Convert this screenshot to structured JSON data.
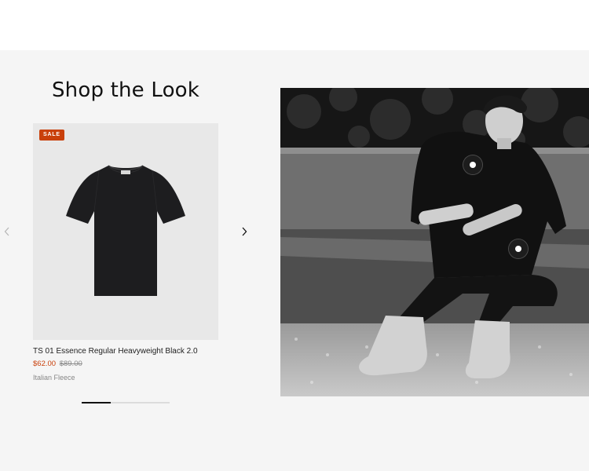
{
  "section": {
    "title": "Shop the Look",
    "background": "#f5f5f5"
  },
  "carousel": {
    "prev_icon": "chevron-left-icon",
    "next_icon": "chevron-right-icon",
    "progress_fraction": 0.33
  },
  "product": {
    "badge": "SALE",
    "badge_color": "#c9400b",
    "name": "TS 01 Essence Regular Heavyweight Black 2.0",
    "sale_price": "$62.00",
    "original_price": "$89.00",
    "vendor": "Italian Fleece"
  },
  "lookbook": {
    "hotspot_count": 2
  }
}
